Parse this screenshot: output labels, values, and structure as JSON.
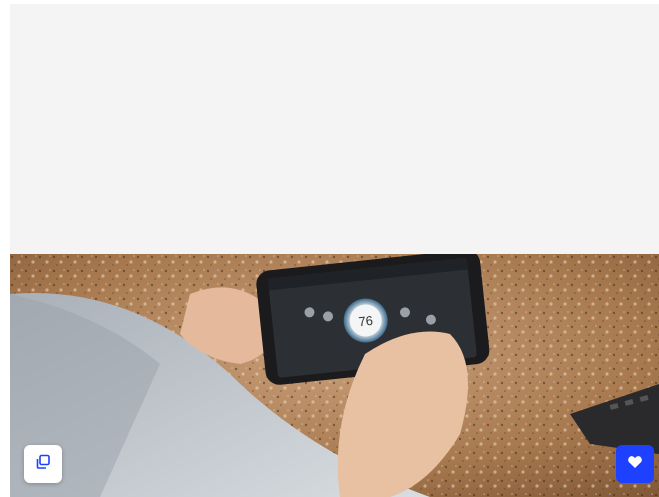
{
  "placeholder": {
    "color": "#f4f4f4"
  },
  "photo": {
    "description_icon": "tablet-thermostat-photo",
    "screen": {
      "temperature": "76"
    }
  },
  "actions": {
    "copy": {
      "icon": "copy-icon"
    },
    "favorite": {
      "icon": "heart-icon",
      "color": "#1e40ff"
    }
  }
}
